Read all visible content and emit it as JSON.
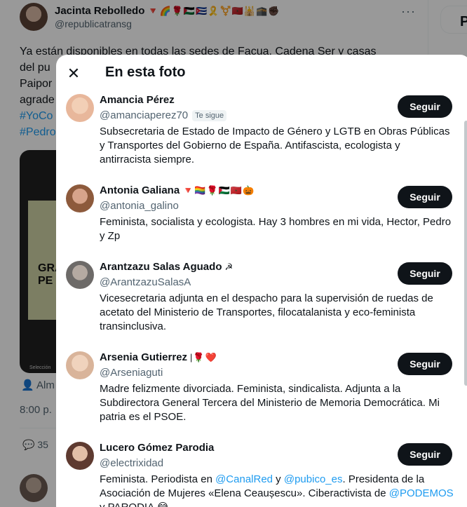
{
  "tweet": {
    "author_name": "Jacinta Rebolledo",
    "author_emojis": "🔻🌈🌹🇵🇸🇨🇺🎗️⚧️🇲🇦🕌🕋✊🏿",
    "author_handle": "@republicatransg",
    "more_icon": "more-icon",
    "text_line1": "Ya están disponibles en todas las sedes de Facua, Cadena Ser y casas",
    "text_line2": "del pu",
    "text_line3": "Paipor",
    "text_line4": "agrade",
    "hashtag1": "#YoCo",
    "hashtag2": "#Pedro",
    "media_text": "GRA PE",
    "media_caption": "Selección",
    "location": "Alm",
    "time": "8:00 p.",
    "replies_count": "35",
    "side_letter": "P"
  },
  "modal": {
    "close_icon": "close-icon",
    "title": "En esta foto",
    "follow_label": "Seguir",
    "users": [
      {
        "name": "Amancia Pérez",
        "emojis": "",
        "handle": "@amanciaperez70",
        "badge": "Te sigue",
        "bio": "Subsecretaria de Estado de Impacto de Género y LGTB en Obras Públicas y Transportes del Gobierno de España. Antifascista, ecologista y antirracista siempre.",
        "avatar_color": "#e8b79b"
      },
      {
        "name": "Antonia Galiana",
        "emojis": "🔻🏳️‍🌈🌹🇵🇸🇲🇦🎃",
        "handle": "@antonia_galino",
        "bio": "Feminista, socialista y ecologista. Hay 3 hombres en mi vida, Hector, Pedro y Zp",
        "avatar_color": "#b07a5a"
      },
      {
        "name": "Arantzazu Salas Aguado",
        "emojis": "☭",
        "handle": "@ArantzazuSalasA",
        "bio": "Vicesecretaria adjunta en el despacho para la supervisión de ruedas de acetato del Ministerio de Transportes, filocatalanista y eco-feminista transinclusiva.",
        "avatar_color": "#8a8a8a"
      },
      {
        "name": "Arsenia Gutierrez",
        "emojis": "|🌹❤️",
        "handle": "@Arseniaguti",
        "bio": "Madre felizmente divorciada. Feminista, sindicalista. Adjunta a la Subdirectora General Tercera del Ministerio de Memoria Democrática. Mi patria es el PSOE.",
        "avatar_color": "#d9b49a"
      },
      {
        "name": "Lucero Gómez Parodia",
        "emojis": "",
        "handle": "@electrixidad",
        "bio_before": "Feminista. Periodista en ",
        "mention1": "@CanalRed",
        "bio_mid": " y ",
        "mention2": "@pubico_es",
        "bio_after": ". Presidenta de la Asociación de Mujeres «Elena Ceaușescu». Ciberactivista de ",
        "mention3": "@PODEMOS",
        "bio_end": " y PARODIA 😂",
        "avatar_color": "#8b5e4e"
      }
    ]
  }
}
